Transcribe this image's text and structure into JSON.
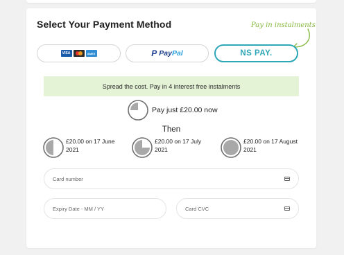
{
  "page": {
    "title": "Select Your Payment Method",
    "promo": "Pay in instalments"
  },
  "methods": {
    "cards": {
      "visa": "VISA",
      "mastercard": "",
      "amex": "AMEX"
    },
    "paypal": {
      "pay": "Pay",
      "pal": "Pal"
    },
    "ns_pay": "NS PAY."
  },
  "selected_method": "ns_pay",
  "banner": "Spread the cost. Pay in 4 interest free instalments",
  "now": {
    "text": "Pay just £20.00 now",
    "fraction": 0.25
  },
  "then_label": "Then",
  "instalments": [
    {
      "text": "£20.00 on 17 June 2021",
      "fraction": 0.5
    },
    {
      "text": "£20.00 on 17 July 2021",
      "fraction": 0.75
    },
    {
      "text": "£20.00 on 17 August 2021",
      "fraction": 1.0
    }
  ],
  "fields": {
    "card_number": "Card number",
    "expiry": "Expiry Date - MM / YY",
    "cvc": "Card CVC"
  },
  "colors": {
    "accent_teal": "#2ea7b7",
    "promo_green": "#86b83e",
    "banner_bg": "#e4f2d6",
    "pie_fill": "#a8a8a8"
  },
  "icons": {
    "promo_arrow": "curved-arrow-icon",
    "field_icon": "credit-card-icon"
  }
}
